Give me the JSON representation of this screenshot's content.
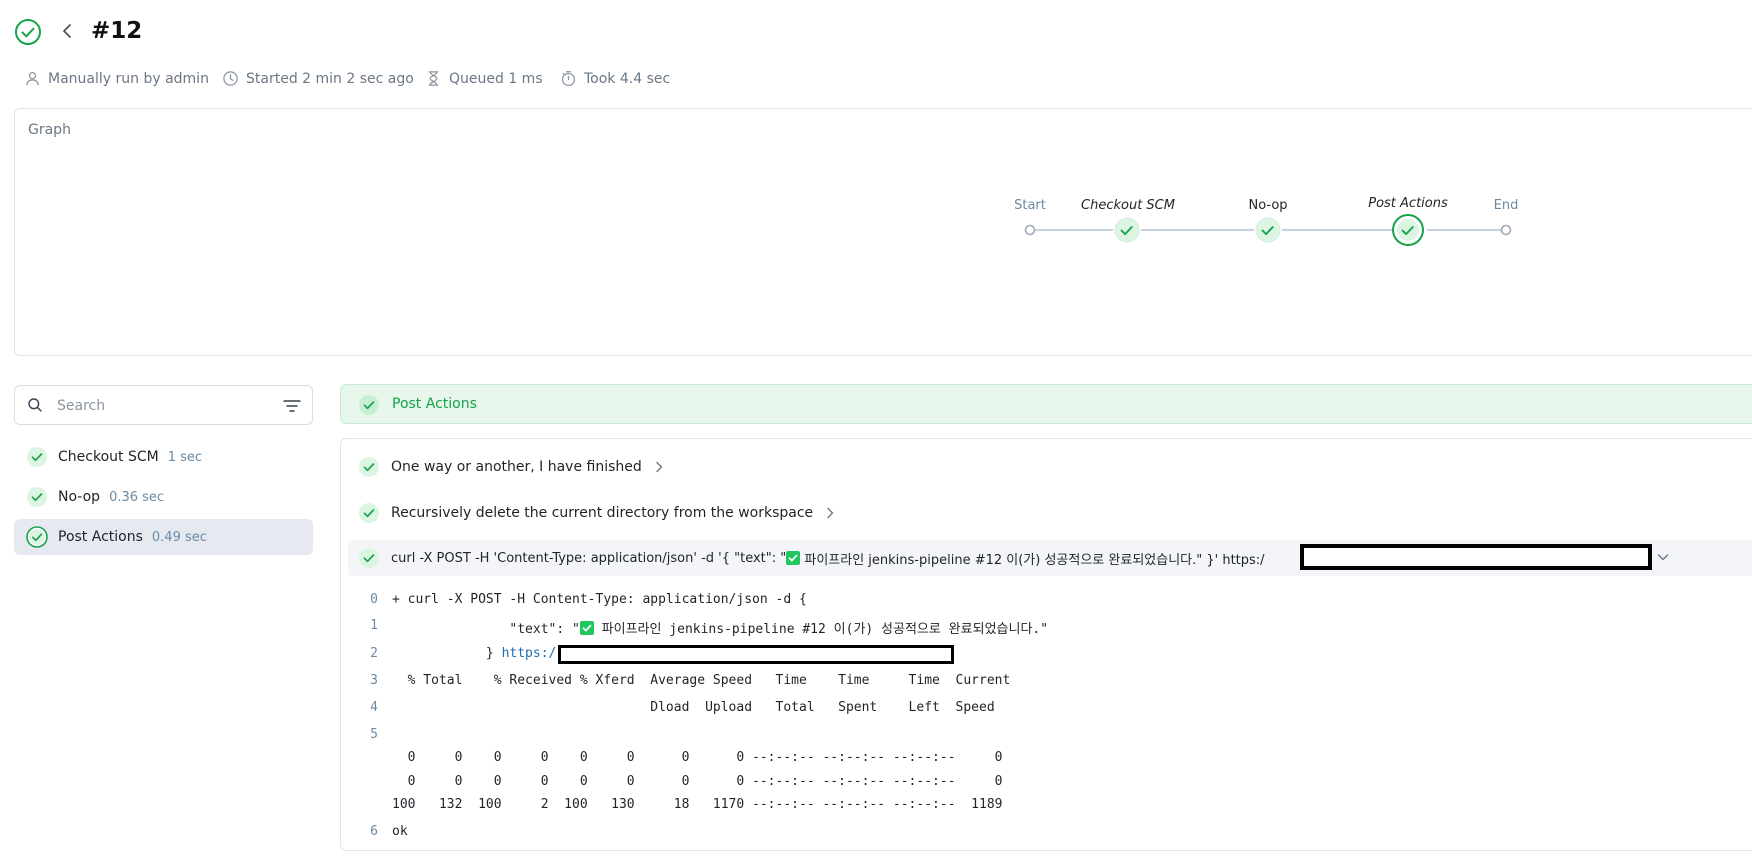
{
  "header": {
    "title": "#12",
    "meta": [
      {
        "icon": "user-icon",
        "text": "Manually run by admin"
      },
      {
        "icon": "clock-icon",
        "text": "Started 2 min 2 sec ago"
      },
      {
        "icon": "hourglass-icon",
        "text": "Queued 1 ms"
      },
      {
        "icon": "timer-icon",
        "text": "Took 4.4 sec"
      }
    ]
  },
  "graph": {
    "label": "Graph",
    "nodes": [
      {
        "label": "Start",
        "kind": "endpoint"
      },
      {
        "label": "Checkout SCM",
        "kind": "stage"
      },
      {
        "label": "No-op",
        "kind": "stage"
      },
      {
        "label": "Post Actions",
        "kind": "stage-selected"
      },
      {
        "label": "End",
        "kind": "endpoint"
      }
    ]
  },
  "search": {
    "placeholder": "Search"
  },
  "stages": [
    {
      "name": "Checkout SCM",
      "duration": "1 sec"
    },
    {
      "name": "No-op",
      "duration": "0.36 sec"
    },
    {
      "name": "Post Actions",
      "duration": "0.49 sec",
      "selected": true
    }
  ],
  "selected_stage": {
    "label": "Post Actions"
  },
  "steps": [
    {
      "label": "One way or another, I have finished"
    },
    {
      "label": "Recursively delete the current directory from the workspace"
    },
    {
      "label_before_emoji": "curl -X POST -H 'Content-Type: application/json' -d '{ \"text\": \"",
      "label_after_emoji": " 파이프라인 jenkins-pipeline #12 이(가) 성공적으로 완료되었습니다.\" }' https:/"
    }
  ],
  "console": {
    "lines": [
      {
        "n": "0",
        "text": "+ curl -X POST -H Content-Type: application/json -d {"
      },
      {
        "n": "1",
        "before": "               \"text\": \"",
        "after": " 파이프라인 jenkins-pipeline #12 이(가) 성공적으로 완료되었습니다.\""
      },
      {
        "n": "2",
        "before": "            } ",
        "link": "https:/"
      },
      {
        "n": "3",
        "text": "  % Total    % Received % Xferd  Average Speed   Time    Time     Time  Current"
      },
      {
        "n": "4",
        "text": "                                 Dload  Upload   Total   Spent    Left  Speed"
      },
      {
        "n": "5",
        "text": ""
      },
      {
        "n": "",
        "text": "  0     0    0     0    0     0      0      0 --:--:-- --:--:-- --:--:--     0"
      },
      {
        "n": "",
        "text": "  0     0    0     0    0     0      0      0 --:--:-- --:--:-- --:--:--     0"
      },
      {
        "n": "",
        "text": "100   132  100     2  100   130     18   1170 --:--:-- --:--:-- --:--:--  1189"
      },
      {
        "n": "6",
        "text": "ok"
      }
    ]
  },
  "colors": {
    "success": "#16a34a",
    "success_bg": "#e7f7ec",
    "muted": "#6b7785"
  }
}
